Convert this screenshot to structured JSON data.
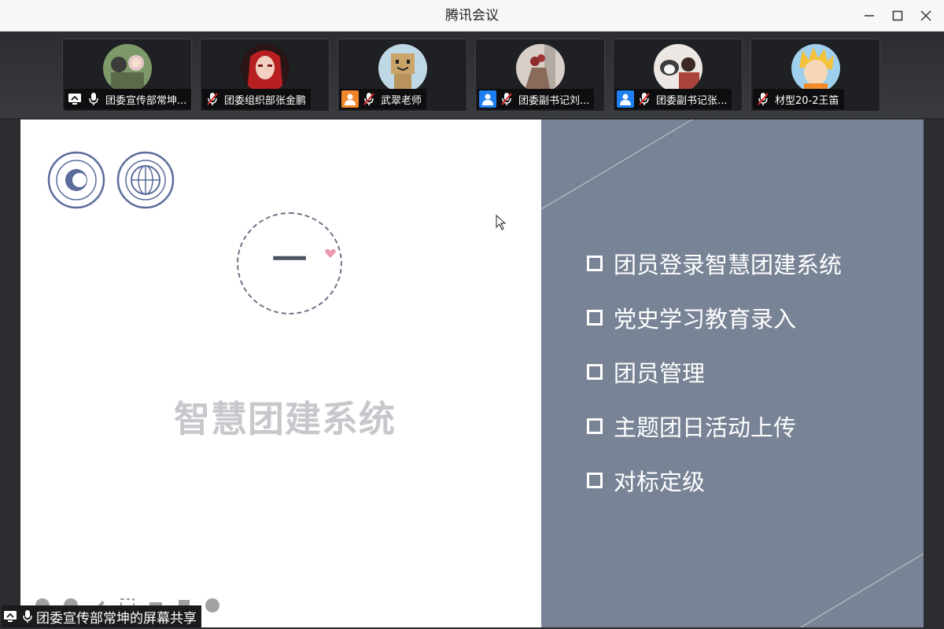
{
  "window": {
    "title": "腾讯会议",
    "controls": [
      "minimize-icon",
      "maximize-icon",
      "close-icon"
    ]
  },
  "participants": [
    {
      "name": "团委宣传部常坤...",
      "icons": [
        "screen-share-icon",
        "microphone-icon"
      ],
      "avatar": "anime-group-avatar"
    },
    {
      "name": "团委组织部张金鹏",
      "icons": [
        "microphone-muted-icon"
      ],
      "avatar": "red-hair-anime-avatar"
    },
    {
      "name": "武翠老师",
      "icons": [
        "user-badge-icon",
        "microphone-muted-icon"
      ],
      "avatar": "cardboard-robot-avatar"
    },
    {
      "name": "团委副书记刘...",
      "icons": [
        "user-badge-icon",
        "microphone-muted-icon"
      ],
      "avatar": "flower-bouquet-avatar"
    },
    {
      "name": "团委副书记张...",
      "icons": [
        "user-badge-icon",
        "microphone-muted-icon"
      ],
      "avatar": "cat-person-avatar"
    },
    {
      "name": "材型20-2王笛",
      "icons": [
        "microphone-muted-icon"
      ],
      "avatar": "naruto-avatar"
    }
  ],
  "slide": {
    "section_numeral": "一",
    "title": "智慧团建系统",
    "menu_items": [
      "团员登录智慧团建系统",
      "党史学习教育录入",
      "团员管理",
      "主题团日活动上传",
      "对标定级"
    ],
    "colors": {
      "right_panel": "#788395",
      "title_text": "#c6c8cc",
      "circle": "#6b7384"
    }
  },
  "share": {
    "label": "团委宣传部常坤的屏幕共享",
    "icons": [
      "screen-share-icon",
      "microphone-icon"
    ]
  }
}
